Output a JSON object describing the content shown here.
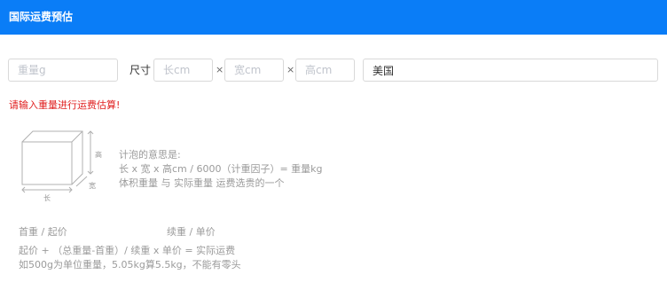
{
  "header": {
    "title": "国际运费预估"
  },
  "form": {
    "weight_placeholder": "重量g",
    "size_label": "尺寸",
    "length_placeholder": "长cm",
    "width_placeholder": "宽cm",
    "height_placeholder": "高cm",
    "times_symbol": "×",
    "country_value": "美国"
  },
  "error_message": "请输入重量进行运费估算!",
  "box_diagram": {
    "height_label": "高",
    "width_label": "宽",
    "length_label": "长"
  },
  "volume_info": {
    "line1": "计泡的意思是:",
    "line2": "长 x 宽 x 高cm / 6000（计重因子）= 重量kg",
    "line3": "体积重量 与 实际重量 运费选贵的一个"
  },
  "fee_info": {
    "first_weight_label": "首重 / 起价",
    "continued_weight_label": "续重 / 单价",
    "formula": "起价 + （总重量-首重）/ 续重 x 单价 = 实际运费",
    "note": "如500g为单位重量，5.05kg算5.5kg，不能有零头"
  }
}
